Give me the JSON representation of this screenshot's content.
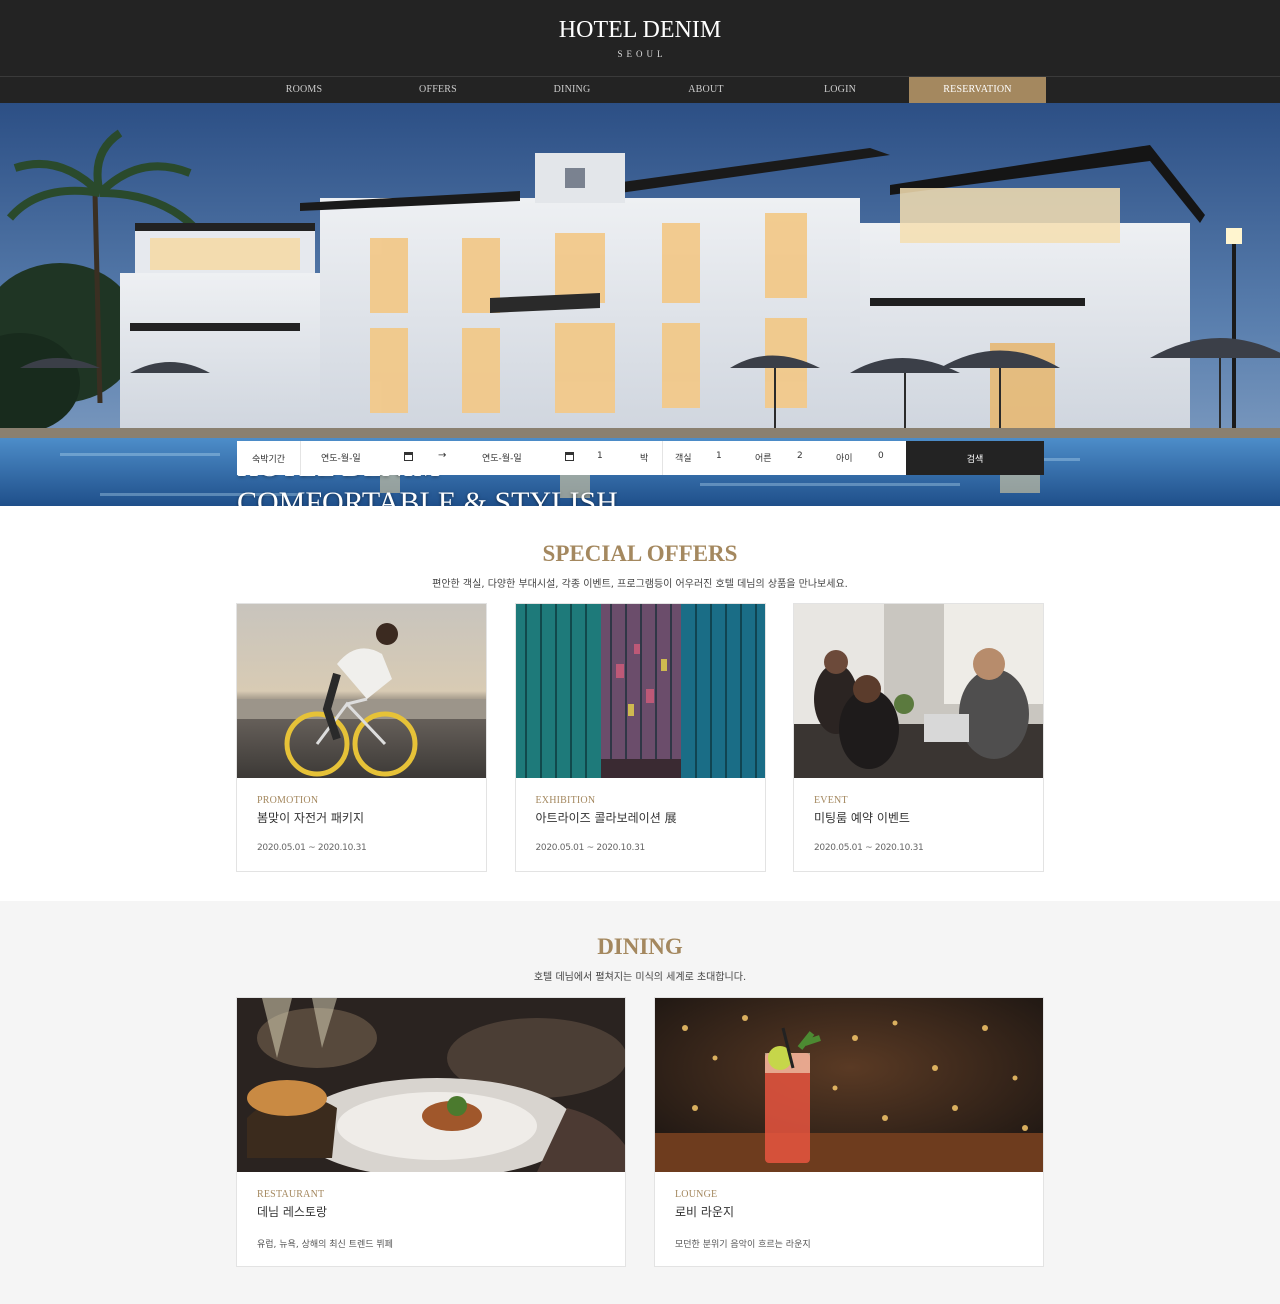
{
  "header": {
    "logo_title": "HOTEL DENIM",
    "logo_sub": "SEOUL"
  },
  "nav": {
    "items": [
      "ROOMS",
      "OFFERS",
      "DINING",
      "ABOUT",
      "LOGIN"
    ],
    "reservation": "RESERVATION"
  },
  "hero": {
    "line1": "HOTEL DENIM",
    "line2": "COMFORTABLE & STYLISH"
  },
  "booking": {
    "stay_label": "숙박기간",
    "checkin_placeholder": "연도-월-일",
    "arrow": "→",
    "checkout_placeholder": "연도-월-일",
    "nights_value": "1",
    "nights_unit": "박",
    "rooms_label": "객실",
    "rooms_value": "1",
    "adults_label": "어른",
    "adults_value": "2",
    "children_label": "아이",
    "children_value": "0",
    "search_label": "검색"
  },
  "offers": {
    "title": "SPECIAL OFFERS",
    "description": "편안한 객실, 다양한 부대시설, 각종 이벤트, 프로그램등이 어우러진 호텔 데님의 상품을 만나보세요.",
    "cards": [
      {
        "category": "PROMOTION",
        "title": "봄맞이 자전거 패키지",
        "period": "2020.05.01 ~ 2020.10.31",
        "image_icon": "cyclist-photo"
      },
      {
        "category": "EXHIBITION",
        "title": "아트라이즈 콜라보레이션 展",
        "period": "2020.05.01 ~ 2020.10.31",
        "image_icon": "art-installation-photo"
      },
      {
        "category": "EVENT",
        "title": "미팅룸 예약 이벤트",
        "period": "2020.05.01 ~ 2020.10.31",
        "image_icon": "meeting-photo"
      }
    ]
  },
  "dining": {
    "title": "DINING",
    "description": "호텔 데님에서 펼쳐지는 미식의 세계로 초대합니다.",
    "cards": [
      {
        "category": "RESTAURANT",
        "title": "데님 레스토랑",
        "description": "유럽, 뉴욕, 상해의 최신 트렌드 뷔페",
        "image_icon": "restaurant-dish-photo"
      },
      {
        "category": "LOUNGE",
        "title": "로비 라운지",
        "description": "모던한 분위기 음악이 흐르는 라운지",
        "image_icon": "cocktail-photo"
      }
    ]
  },
  "colors": {
    "accent_gold": "#a4885f",
    "header_dark": "#232323",
    "dining_bg": "#f5f5f5"
  }
}
